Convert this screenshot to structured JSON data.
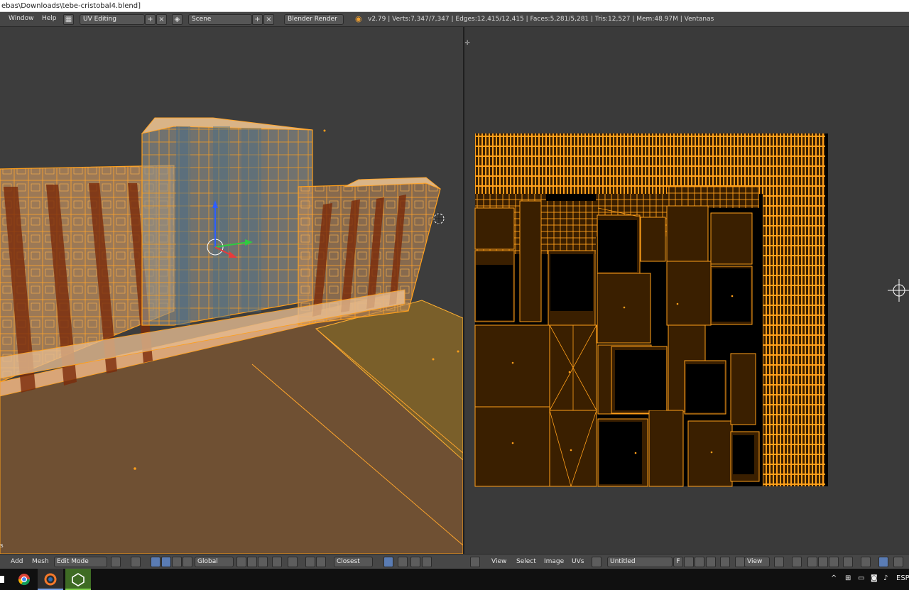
{
  "titlebar": {
    "path": "ebas\\Downloads\\tebe-cristobal4.blend]"
  },
  "infobar": {
    "menu_window": "Window",
    "menu_help": "Help",
    "screen_layout": "UV Editing",
    "scene": "Scene",
    "render_engine": "Blender Render",
    "stats": "v2.79 | Verts:7,347/7,347 | Edges:12,415/12,415 | Faces:5,281/5,281 | Tris:12,527 | Mem:48.97M | Ventanas"
  },
  "view3d_header": {
    "corner_text": "s",
    "menu_add": "Add",
    "menu_mesh": "Mesh",
    "mode": "Edit Mode",
    "orientation": "Global",
    "snap_target": "Closest"
  },
  "uv_header": {
    "menu_view": "View",
    "menu_select": "Select",
    "menu_image": "Image",
    "menu_uvs": "UVs",
    "image_name": "Untitled",
    "fake_user": "F",
    "view_label": "View"
  },
  "taskbar": {
    "apps": [
      "windows-icon",
      "chrome-icon",
      "blender-icon",
      "unity-icon"
    ],
    "tray_lang": "ESP"
  },
  "colors": {
    "wire": "#ff9f1a",
    "panel": "#464646",
    "viewport_bg": "#3d3d3d",
    "uv_fill": "#3a1f00"
  }
}
